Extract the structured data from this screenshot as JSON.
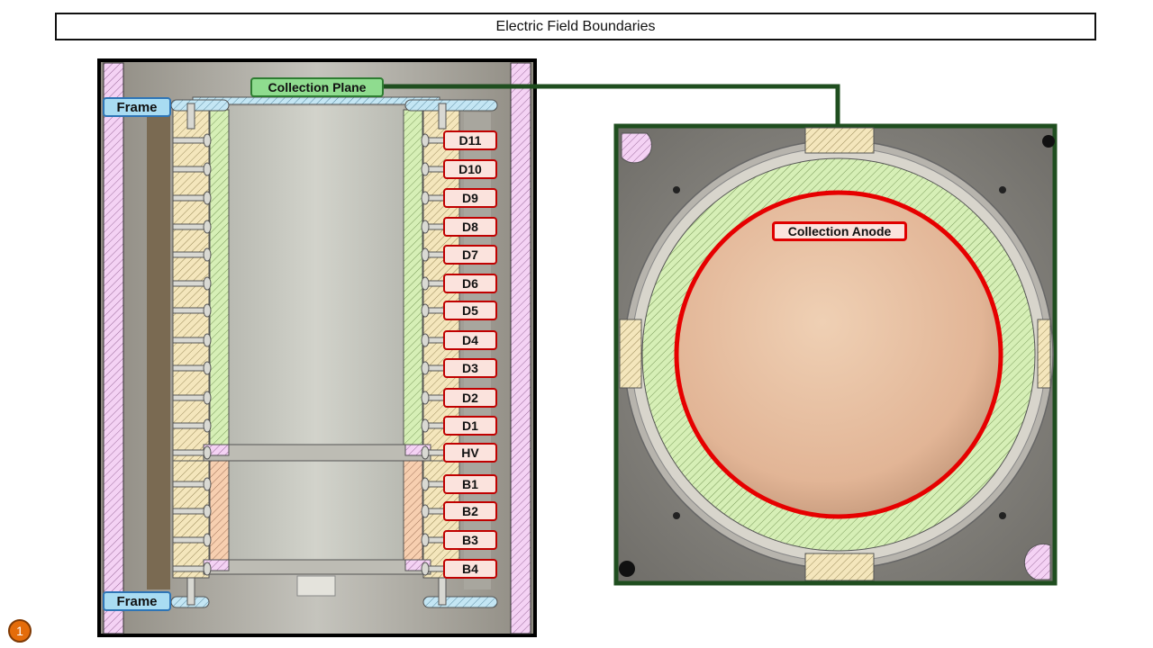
{
  "title": "Electric Field Boundaries",
  "labels": {
    "collection_plane": "Collection Plane",
    "collection_anode": "Collection Anode",
    "frame_top": "Frame",
    "frame_bottom": "Frame"
  },
  "electrodes": [
    "D11",
    "D10",
    "D9",
    "D8",
    "D7",
    "D6",
    "D5",
    "D4",
    "D3",
    "D2",
    "D1",
    "HV",
    "B1",
    "B2",
    "B3",
    "B4"
  ],
  "slide_number": "1",
  "colors": {
    "drift_hatch": "#c9e8a7",
    "spacer_hatch": "#f2e2b0",
    "bottom_hatch": "#f6c9a8",
    "frame_hatch": "#f0c6f0",
    "plane_hatch": "#b9e0f0",
    "leader_line": "#1f4e1f",
    "anode_ring": "#e60000"
  }
}
